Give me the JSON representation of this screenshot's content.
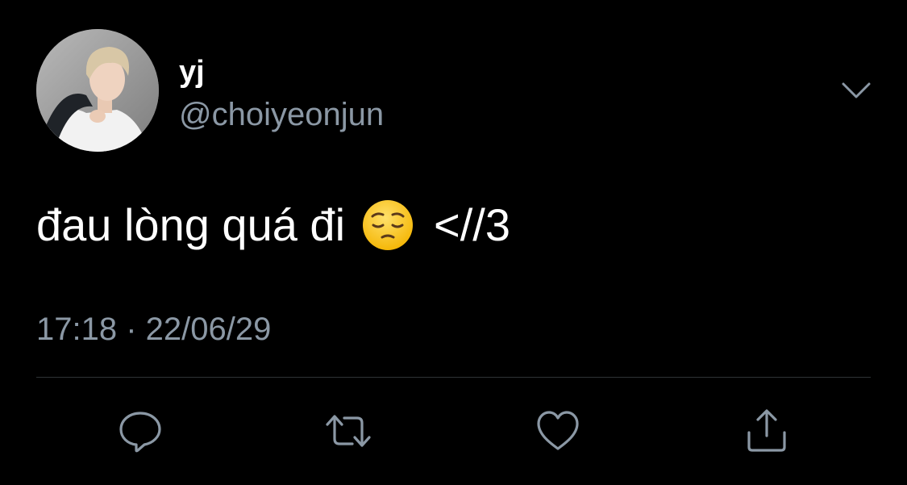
{
  "author": {
    "display_name": "yj",
    "handle": "@choiyeonjun"
  },
  "tweet": {
    "text_before_emoji": "đau lòng quá đi",
    "emoji": "pensive-face",
    "text_after_emoji": "<//3"
  },
  "meta": {
    "timestamp": "17:18 · 22/06/29"
  },
  "icons": {
    "menu": "chevron-down-icon",
    "reply": "reply-icon",
    "retweet": "retweet-icon",
    "like": "heart-icon",
    "share": "share-icon"
  },
  "colors": {
    "background": "#000000",
    "primary_text": "#ffffff",
    "secondary_text": "#8b98a5",
    "divider": "#2f3336",
    "icon": "#8b98a5"
  }
}
